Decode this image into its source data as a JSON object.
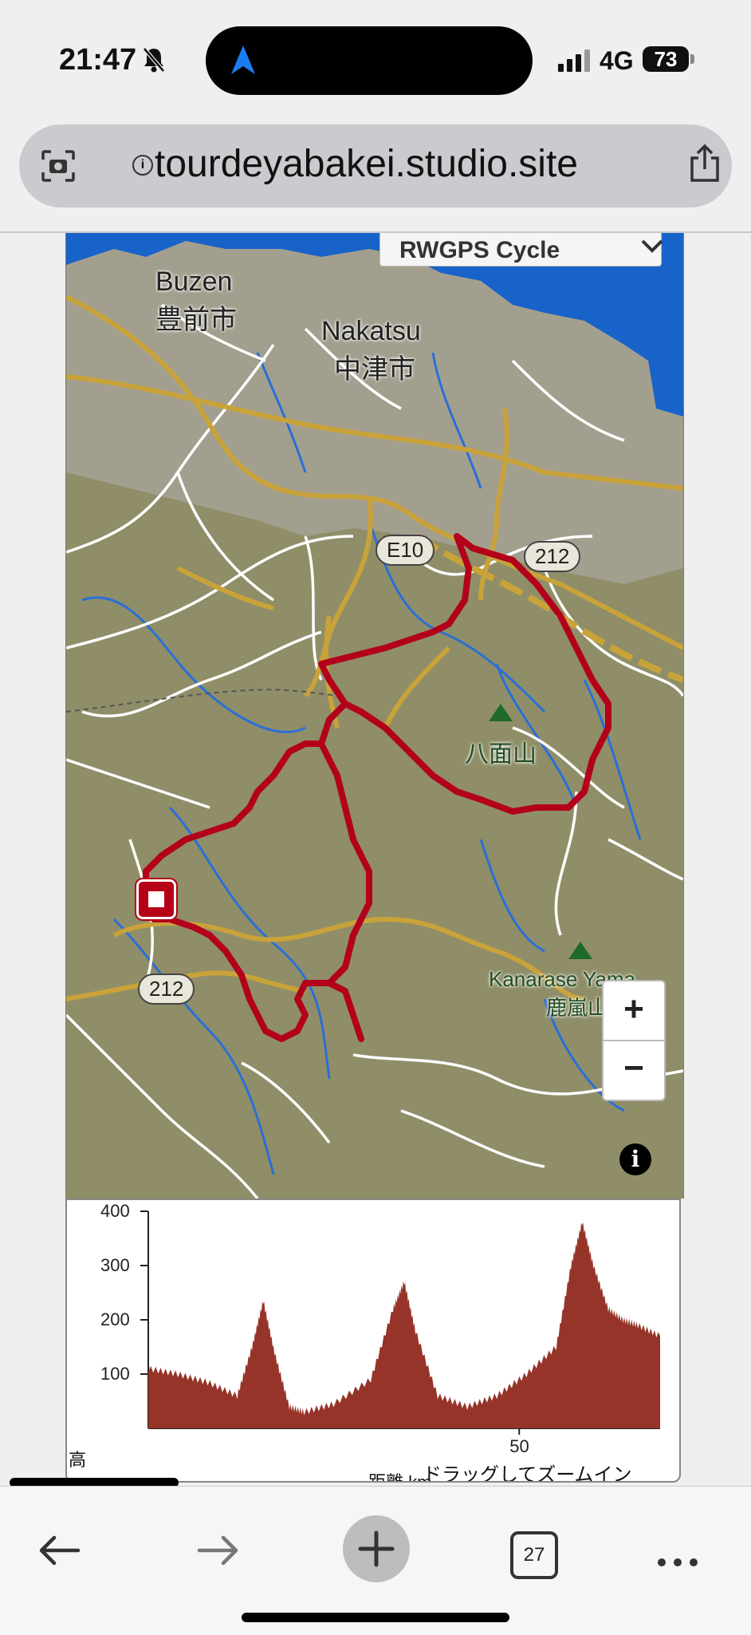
{
  "status_bar": {
    "time": "21:47",
    "network": "4G",
    "battery": "73"
  },
  "browser": {
    "url": "tourdeyabakei.studio.site",
    "tab_count": "27"
  },
  "map": {
    "layer_select": "RWGPS Cycle",
    "places": [
      {
        "id": "buzen",
        "en": "Buzen",
        "ja": "豊前市"
      },
      {
        "id": "nakatsu",
        "en": "Nakatsu",
        "ja": "中津市"
      },
      {
        "id": "hachimen",
        "ja": "八面山"
      },
      {
        "id": "kanarase",
        "en": "Kanarase Yama",
        "ja": "鹿嵐山"
      }
    ],
    "road_shields": [
      "E10",
      "212",
      "212"
    ],
    "zoom_in": "+",
    "zoom_out": "−",
    "info": "i"
  },
  "elevation": {
    "y_label": "高",
    "x_label": "距離 km",
    "hint": "ドラッグしてズームイン"
  },
  "chart_data": {
    "type": "area",
    "title": "",
    "xlabel": "距離 km",
    "ylabel": "高",
    "ylim": [
      0,
      400
    ],
    "yticks": [
      100,
      200,
      300,
      400
    ],
    "xticks": [
      50
    ],
    "xlim": [
      0,
      69
    ],
    "x": [
      0,
      4,
      8,
      12,
      14,
      15.5,
      17,
      19,
      21,
      25,
      30,
      33,
      34.5,
      36,
      39,
      43,
      47,
      51,
      55,
      57,
      58.5,
      60,
      62,
      64,
      66,
      69
    ],
    "y": [
      110,
      100,
      85,
      60,
      150,
      235,
      140,
      40,
      30,
      45,
      90,
      220,
      270,
      180,
      60,
      40,
      60,
      100,
      150,
      300,
      380,
      300,
      220,
      200,
      190,
      170
    ],
    "colors": {
      "fill": "#963429"
    }
  }
}
